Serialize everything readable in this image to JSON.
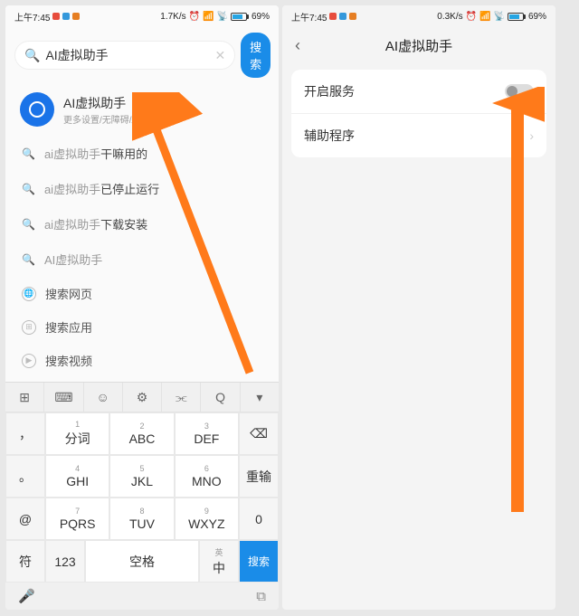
{
  "statusbar": {
    "time": "上午7:45",
    "net_left": "1.7K/s",
    "net_right": "0.3K/s",
    "battery": "69%"
  },
  "search": {
    "value": "AI虚拟助手",
    "button": "搜索"
  },
  "result": {
    "title": "AI虚拟助手",
    "sub": "更多设置/无障碍/AI虚拟助手"
  },
  "suggestions": [
    {
      "prefix": "ai虚拟助手",
      "bold": "干嘛用的"
    },
    {
      "prefix": "ai虚拟助手",
      "bold": "已停止运行"
    },
    {
      "prefix": "ai虚拟助手",
      "bold": "下载安装"
    },
    {
      "prefix": "AI虚拟助手",
      "bold": ""
    }
  ],
  "actions": {
    "web": "搜索网页",
    "app": "搜索应用",
    "video": "搜索视频"
  },
  "keyboard": {
    "row1": [
      {
        "sup": "1",
        "label": "分词"
      },
      {
        "sup": "2",
        "label": "ABC"
      },
      {
        "sup": "3",
        "label": "DEF"
      }
    ],
    "row2": [
      {
        "sup": "4",
        "label": "GHI"
      },
      {
        "sup": "5",
        "label": "JKL"
      },
      {
        "sup": "6",
        "label": "MNO"
      }
    ],
    "row3": [
      {
        "sup": "7",
        "label": "PQRS"
      },
      {
        "sup": "8",
        "label": "TUV"
      },
      {
        "sup": "9",
        "label": "WXYZ"
      }
    ],
    "side_left_top": "，",
    "side_left_mid": "。",
    "side_left_sym": "符",
    "side_left_num": "123",
    "side_right_retype": "重输",
    "side_right_zero": "0",
    "space": "空格",
    "lang": "中",
    "search": "搜索"
  },
  "right": {
    "title": "AI虚拟助手",
    "enable_label": "开启服务",
    "helper_label": "辅助程序"
  }
}
